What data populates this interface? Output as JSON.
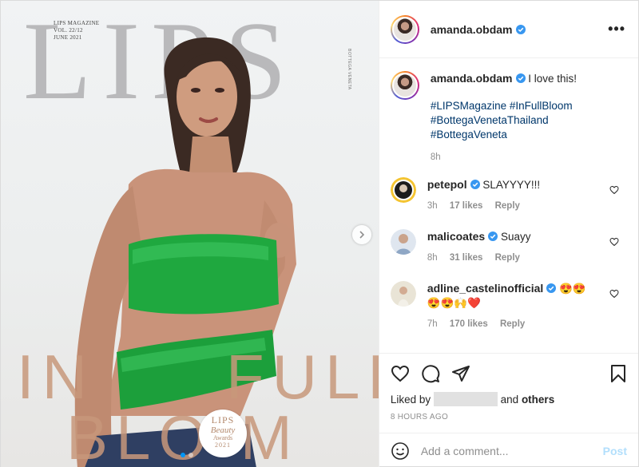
{
  "cover": {
    "title": "LIPS",
    "magazine_meta": [
      "LIPS MAGAZINE",
      "VOL. 22/12",
      "JUNE 2021"
    ],
    "side_text": "BOTTEGA VENETA",
    "headline_1": "IN",
    "headline_2": "FULL",
    "headline_3": "BLO  M",
    "award": [
      "LIPS",
      "Beauty",
      "Awards",
      "2021"
    ],
    "carousel_dots": 2,
    "active_dot": 0
  },
  "header": {
    "username": "amanda.obdam",
    "verified": true,
    "more_icon": "more-horizontal-icon"
  },
  "caption": {
    "username": "amanda.obdam",
    "text": "I love this!",
    "hashtags": [
      "#LIPSMagazine #InFullBloom",
      "#BottegaVenetaThailand",
      "#BottegaVeneta"
    ],
    "time": "8h"
  },
  "comments": [
    {
      "username": "petepol",
      "verified": true,
      "text": "SLAYYYY!!!",
      "time": "3h",
      "likes": "17 likes",
      "reply": "Reply"
    },
    {
      "username": "malicoates",
      "verified": true,
      "text": "Suayy",
      "time": "8h",
      "likes": "31 likes",
      "reply": "Reply"
    },
    {
      "username": "adline_castelinofficial",
      "verified": true,
      "text": "😍😍",
      "text2": "😍😍🙌❤️",
      "time": "7h",
      "likes": "170 likes",
      "reply": "Reply"
    }
  ],
  "actions": {
    "liked_by_prefix": "Liked by",
    "liked_by_suffix": "and",
    "others": "others",
    "timestamp": "8 HOURS AGO"
  },
  "add_comment": {
    "placeholder": "Add a comment...",
    "post_label": "Post"
  },
  "colors": {
    "verified": "#3897f0",
    "link": "#00376b",
    "post_disabled": "#b2dffc",
    "accent": "#0095f6"
  }
}
